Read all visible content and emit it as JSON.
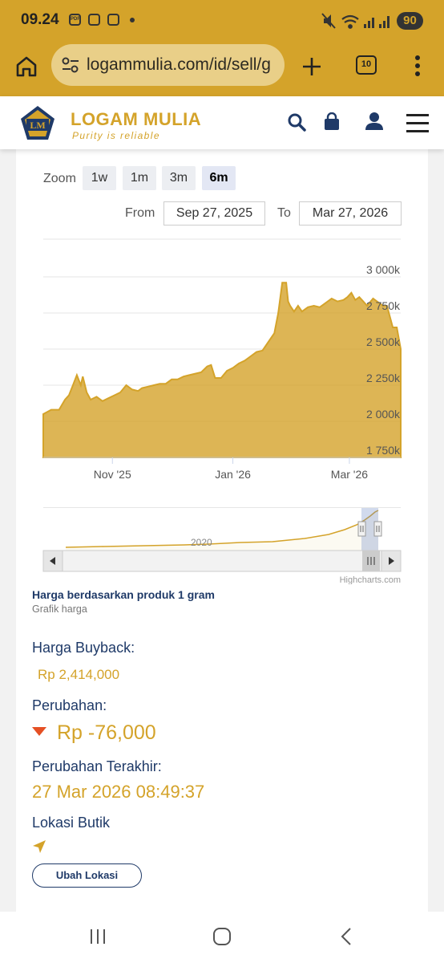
{
  "status": {
    "time": "09.24",
    "battery": "90"
  },
  "browser": {
    "url": "logammulia.com/id/sell/g",
    "tab_count": "10"
  },
  "site": {
    "brand": "LOGAM MULIA",
    "tagline": "Purity is reliable",
    "logo_text": "LM"
  },
  "chart_controls": {
    "zoom_label": "Zoom",
    "zoom_buttons": [
      "1w",
      "1m",
      "3m",
      "6m"
    ],
    "active_zoom": "6m",
    "from_label": "From",
    "from_value": "Sep 27, 2025",
    "to_label": "To",
    "to_value": "Mar 27, 2026"
  },
  "chart_data": {
    "type": "area",
    "x": [
      "2025-09-27",
      "2025-10-01",
      "2025-10-05",
      "2025-10-08",
      "2025-10-10",
      "2025-10-12",
      "2025-10-14",
      "2025-10-16",
      "2025-10-17",
      "2025-10-19",
      "2025-10-21",
      "2025-10-24",
      "2025-10-27",
      "2025-10-30",
      "2025-11-02",
      "2025-11-05",
      "2025-11-08",
      "2025-11-11",
      "2025-11-14",
      "2025-11-16",
      "2025-11-19",
      "2025-11-22",
      "2025-11-25",
      "2025-11-28",
      "2025-12-01",
      "2025-12-04",
      "2025-12-07",
      "2025-12-10",
      "2025-12-13",
      "2025-12-16",
      "2025-12-19",
      "2025-12-21",
      "2025-12-23",
      "2025-12-26",
      "2025-12-29",
      "2026-01-01",
      "2026-01-04",
      "2026-01-07",
      "2026-01-10",
      "2026-01-13",
      "2026-01-16",
      "2026-01-19",
      "2026-01-22",
      "2026-01-24",
      "2026-01-26",
      "2026-01-28",
      "2026-01-29",
      "2026-01-30",
      "2026-02-01",
      "2026-02-03",
      "2026-02-05",
      "2026-02-08",
      "2026-02-11",
      "2026-02-14",
      "2026-02-17",
      "2026-02-20",
      "2026-02-23",
      "2026-02-26",
      "2026-02-28",
      "2026-03-02",
      "2026-03-04",
      "2026-03-06",
      "2026-03-08",
      "2026-03-10",
      "2026-03-13",
      "2026-03-16",
      "2026-03-18",
      "2026-03-20",
      "2026-03-23",
      "2026-03-25",
      "2026-03-27"
    ],
    "values": [
      2050,
      2080,
      2080,
      2150,
      2180,
      2250,
      2320,
      2250,
      2310,
      2200,
      2150,
      2170,
      2140,
      2160,
      2180,
      2200,
      2250,
      2220,
      2210,
      2230,
      2240,
      2250,
      2260,
      2260,
      2290,
      2290,
      2310,
      2320,
      2330,
      2340,
      2380,
      2390,
      2300,
      2300,
      2350,
      2370,
      2400,
      2420,
      2450,
      2480,
      2490,
      2550,
      2610,
      2750,
      2960,
      2960,
      2830,
      2800,
      2760,
      2800,
      2760,
      2790,
      2800,
      2790,
      2820,
      2850,
      2830,
      2840,
      2860,
      2890,
      2840,
      2860,
      2830,
      2800,
      2850,
      2820,
      2800,
      2800,
      2650,
      2650,
      2500
    ],
    "y_ticks": [
      "1 750k",
      "2 000k",
      "2 250k",
      "2 500k",
      "2 750k",
      "3 000k"
    ],
    "x_ticks": [
      "Nov '25",
      "Jan '26",
      "Mar '26"
    ],
    "ylim": [
      1750,
      3000
    ],
    "navigator_label": "2020",
    "credits": "Highcharts.com",
    "color": "#d4a32a"
  },
  "info": {
    "chart_title": "Harga berdasarkan produk 1 gram",
    "chart_subtitle": "Grafik harga",
    "buyback_label": "Harga Buyback:",
    "buyback_value": "Rp 2,414,000",
    "change_label": "Perubahan:",
    "change_value": "Rp -76,000",
    "last_change_label": "Perubahan Terakhir:",
    "last_change_value": "27 Mar 2026 08:49:37",
    "location_label": "Lokasi Butik",
    "change_location_button": "Ubah Lokasi"
  },
  "colors": {
    "gold": "#d4a32a",
    "navy": "#1f3a68",
    "down": "#e55024"
  }
}
